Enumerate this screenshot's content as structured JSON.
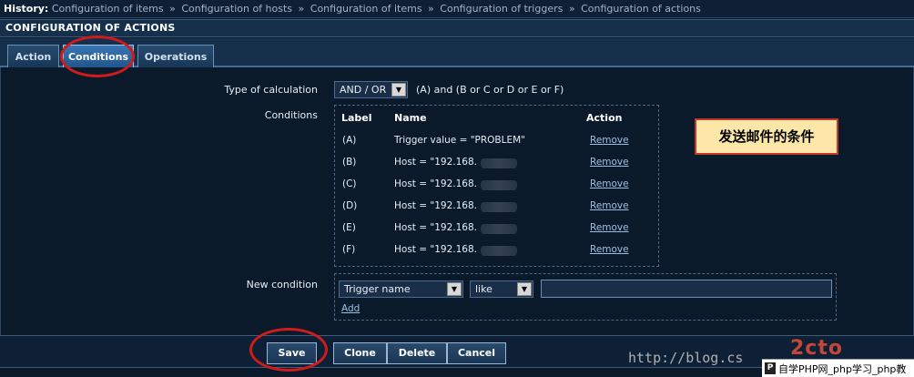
{
  "history": {
    "label": "History:",
    "items": [
      "Configuration of items",
      "Configuration of hosts",
      "Configuration of items",
      "Configuration of triggers",
      "Configuration of actions"
    ],
    "separator": "»"
  },
  "header": {
    "title": "CONFIGURATION OF ACTIONS"
  },
  "tabs": [
    {
      "label": "Action"
    },
    {
      "label": "Conditions",
      "active": true
    },
    {
      "label": "Operations"
    }
  ],
  "form": {
    "calc_label": "Type of calculation",
    "calc_value": "AND / OR",
    "calc_expression": "(A) and (B or C or D or E or F)",
    "conditions_label": "Conditions",
    "columns": {
      "label": "Label",
      "name": "Name",
      "action": "Action"
    },
    "conditions": [
      {
        "label": "(A)",
        "name": "Trigger value = \"PROBLEM\"",
        "action": "Remove",
        "blurred": false
      },
      {
        "label": "(B)",
        "name": "Host = \"192.168.",
        "action": "Remove",
        "blurred": true
      },
      {
        "label": "(C)",
        "name": "Host = \"192.168.",
        "action": "Remove",
        "blurred": true
      },
      {
        "label": "(D)",
        "name": "Host = \"192.168.",
        "action": "Remove",
        "blurred": true
      },
      {
        "label": "(E)",
        "name": "Host = \"192.168.",
        "action": "Remove",
        "blurred": true
      },
      {
        "label": "(F)",
        "name": "Host = \"192.168.",
        "action": "Remove",
        "blurred": true
      }
    ],
    "new_condition_label": "New condition",
    "new_condition_type": "Trigger name",
    "new_condition_operator": "like",
    "new_condition_value": "",
    "add_label": "Add"
  },
  "annotation": {
    "note": "发送邮件的条件"
  },
  "buttons": {
    "save": "Save",
    "clone": "Clone",
    "delete": "Delete",
    "cancel": "Cancel"
  },
  "watermark": {
    "url": "http://blog.cs",
    "logo": "2cto",
    "site_text": "自学PHP网_php学习_php教"
  },
  "colors": {
    "background": "#0b1a2b",
    "header_bar": "#16304b",
    "active_tab": "#2f6aa6",
    "link": "#9cc0e4",
    "annotation_oval": "#d11a1a",
    "note_fill": "#fde7a8"
  }
}
